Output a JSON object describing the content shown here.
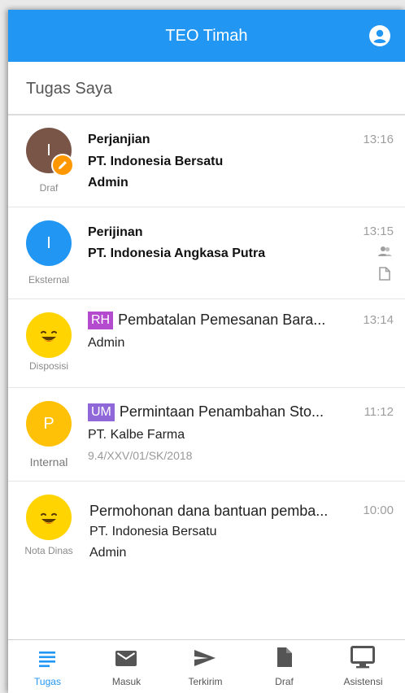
{
  "app": {
    "title": "TEO Timah"
  },
  "section": {
    "title": "Tugas Saya"
  },
  "colors": {
    "primary": "#2196f3",
    "tag_rh": "#b44bcf",
    "tag_um": "#9067d8",
    "edit_badge": "#ff9800"
  },
  "items": [
    {
      "avatar_letter": "I",
      "avatar_color": "#795548",
      "category": "Draf",
      "title": "Perjanjian",
      "line2": "PT. Indonesia Bersatu",
      "line3": "Admin",
      "time": "13:16",
      "icon": "edit-icon"
    },
    {
      "avatar_letter": "I",
      "avatar_color": "#2196f3",
      "category": "Eksternal",
      "title": "Perijinan",
      "line2": "PT. Indonesia Angkasa Putra",
      "time": "13:15",
      "icons": [
        "people-icon",
        "document-icon"
      ]
    },
    {
      "avatar_icon": "smiley-icon",
      "category": "Disposisi",
      "tag": "RH",
      "title": "Pembatalan Pemesanan Bara...",
      "line2": "Admin",
      "time": "13:14"
    },
    {
      "avatar_letter": "P",
      "avatar_color": "#ffc107",
      "category": "Internal",
      "tag": "UM",
      "title": "Permintaan Penambahan Sto...",
      "line2": "PT. Kalbe Farma",
      "line3": "9.4/XXV/01/SK/2018",
      "time": "11:12"
    },
    {
      "avatar_icon": "smiley-icon",
      "category": "Nota Dinas",
      "title": "Permohonan dana bantuan pemba...",
      "line2": "PT. Indonesia Bersatu",
      "line3": "Admin",
      "time": "10:00"
    }
  ],
  "nav": [
    {
      "label": "Tugas",
      "icon": "list-icon",
      "active": true
    },
    {
      "label": "Masuk",
      "icon": "mail-icon"
    },
    {
      "label": "Terkirim",
      "icon": "send-icon"
    },
    {
      "label": "Draf",
      "icon": "file-icon"
    },
    {
      "label": "Asistensi",
      "icon": "monitor-icon"
    }
  ]
}
